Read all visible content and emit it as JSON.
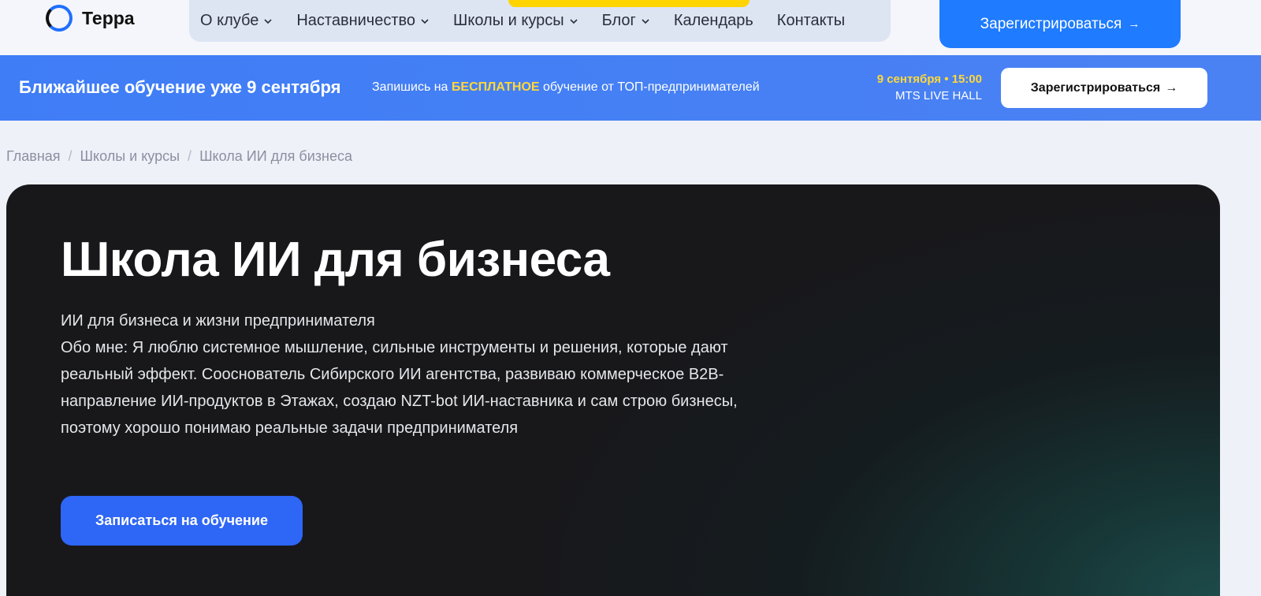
{
  "header": {
    "logo_text": "Терра",
    "nav": [
      {
        "label": "О клубе",
        "has_dropdown": true
      },
      {
        "label": "Наставничество",
        "has_dropdown": true
      },
      {
        "label": "Школы и курсы",
        "has_dropdown": true
      },
      {
        "label": "Блог",
        "has_dropdown": true
      },
      {
        "label": "Календарь",
        "has_dropdown": false
      },
      {
        "label": "Контакты",
        "has_dropdown": false
      }
    ],
    "cta_label": "Зарегистрироваться",
    "cta_arrow": "→"
  },
  "promo": {
    "title": "Ближайшее обучение уже 9 сентября",
    "sub_before": "Запишись на",
    "sub_highlight": "БЕСПЛАТНОЕ",
    "sub_after": "обучение от ТОП-предпринимателей",
    "date": "9 сентября • 15:00",
    "venue": "MTS LIVE HALL",
    "cta_label": "Зарегистрироваться",
    "cta_arrow": "→"
  },
  "breadcrumb": {
    "items": [
      "Главная",
      "Школы и курсы",
      "Школа ИИ для бизнеса"
    ],
    "separator": "/"
  },
  "hero": {
    "title": "Школа ИИ для бизнеса",
    "subtitle": "ИИ для бизнеса и жизни предпринимателя",
    "description": "Обо мне: Я люблю системное мышление, сильные инструменты и решения, которые дают реальный эффект. Сооснователь Сибирского ИИ агентства, развиваю коммерческое B2B-направление ИИ-продуктов в Этажах, создаю NZT-bot ИИ-наставника и сам строю бизнесы, поэтому хорошо понимаю реальные задачи предпринимателя",
    "cta_label": "Записаться на обучение"
  },
  "colors": {
    "accent": "#1f7bff",
    "promo_bg": "#4580f5",
    "highlight": "#ffd83a",
    "hero_bg": "#18181b",
    "hero_cta": "#2e66f5"
  }
}
